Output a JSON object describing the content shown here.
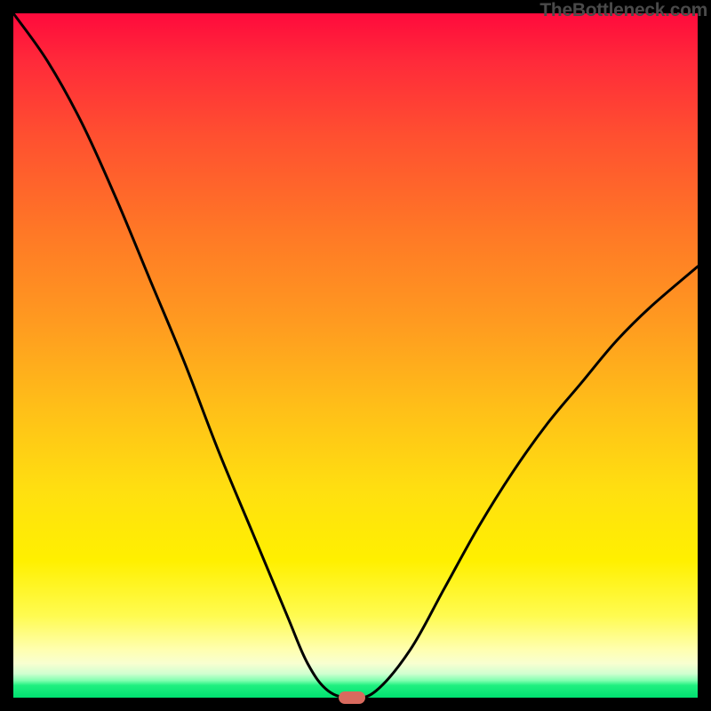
{
  "attribution": "TheBottleneck.com",
  "chart_data": {
    "type": "line",
    "title": "",
    "xlabel": "",
    "ylabel": "",
    "xlim": [
      0,
      100
    ],
    "ylim": [
      0,
      100
    ],
    "grid": false,
    "legend": false,
    "series": [
      {
        "name": "bottleneck-curve",
        "x": [
          0,
          5,
          10,
          15,
          20,
          25,
          30,
          35,
          40,
          43,
          46,
          49.5,
          53,
          58,
          63,
          68,
          73,
          78,
          83,
          88,
          93,
          100
        ],
        "values": [
          100,
          93,
          84,
          73,
          61,
          49,
          36,
          24,
          12,
          5,
          1,
          0,
          1,
          7,
          16,
          25,
          33,
          40,
          46,
          52,
          57,
          63
        ]
      }
    ],
    "marker": {
      "x": 49.5,
      "y": 0,
      "color": "#d96a5e"
    },
    "gradient": {
      "top_color": "#ff0a3c",
      "mid_color": "#ffe010",
      "bottom_color": "#00e070"
    }
  }
}
